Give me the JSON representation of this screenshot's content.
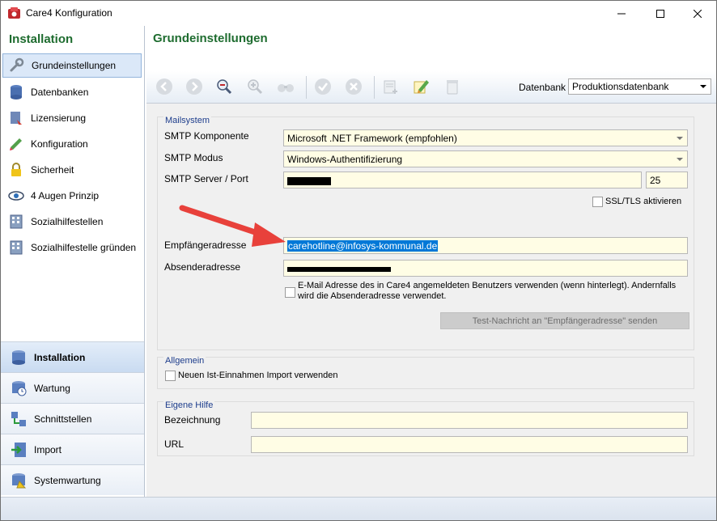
{
  "window": {
    "title": "Care4 Konfiguration",
    "minimize_icon": "minimize-icon",
    "maximize_icon": "maximize-icon",
    "close_icon": "close-icon"
  },
  "sidebar": {
    "header": "Installation",
    "items": [
      {
        "label": "Grundeinstellungen",
        "icon": "wrench-icon"
      },
      {
        "label": "Datenbanken",
        "icon": "database-icon"
      },
      {
        "label": "Lizensierung",
        "icon": "license-icon"
      },
      {
        "label": "Konfiguration",
        "icon": "pencil-icon"
      },
      {
        "label": "Sicherheit",
        "icon": "lock-icon"
      },
      {
        "label": "4 Augen Prinzip",
        "icon": "eye-icon"
      },
      {
        "label": "Sozialhilfestellen",
        "icon": "building-icon"
      },
      {
        "label": "Sozialhilfestelle gründen",
        "icon": "building-icon"
      }
    ],
    "sections": [
      {
        "label": "Installation",
        "icon": "database-install-icon"
      },
      {
        "label": "Wartung",
        "icon": "maintenance-icon"
      },
      {
        "label": "Schnittstellen",
        "icon": "interface-icon"
      },
      {
        "label": "Import",
        "icon": "import-icon"
      },
      {
        "label": "Systemwartung",
        "icon": "system-maintenance-icon"
      }
    ]
  },
  "main": {
    "title": "Grundeinstellungen",
    "toolbar": {
      "buttons": [
        "back-icon",
        "forward-icon",
        "zoom-out-icon",
        "zoom-in-icon",
        "binoculars-icon",
        "confirm-icon",
        "cancel-icon",
        "new-document-icon",
        "edit-icon",
        "delete-icon"
      ],
      "database_label": "Datenbank",
      "database_value": "Produktionsdatenbank"
    },
    "mailsystem": {
      "group_title": "Mailsystem",
      "smtp_component_label": "SMTP Komponente",
      "smtp_component_value": "Microsoft .NET Framework (empfohlen)",
      "smtp_mode_label": "SMTP Modus",
      "smtp_mode_value": "Windows-Authentifizierung",
      "smtp_server_label": "SMTP Server / Port",
      "smtp_port_value": "25",
      "ssl_label": "SSL/TLS aktivieren",
      "recipient_label": "Empfängeradresse",
      "recipient_value": "carehotline@infosys-kommunal.de",
      "sender_label": "Absenderadresse",
      "use_user_email_label": "E-Mail Adresse des in Care4 angemeldeten Benutzers verwenden (wenn hinterlegt). Andernfalls wird die Absenderadresse verwendet.",
      "test_button_label": "Test-Nachricht an \"Empfängeradresse\" senden"
    },
    "general": {
      "group_title": "Allgemein",
      "import_label": "Neuen Ist-Einnahmen Import verwenden"
    },
    "help": {
      "group_title": "Eigene Hilfe",
      "name_label": "Bezeichnung",
      "url_label": "URL"
    }
  },
  "colors": {
    "accent_green": "#1e6c2f",
    "group_title_blue": "#1d3d8c",
    "field_yellow": "#fffde5",
    "selection_blue": "#0078d7",
    "annotation_red": "#e8413b"
  }
}
